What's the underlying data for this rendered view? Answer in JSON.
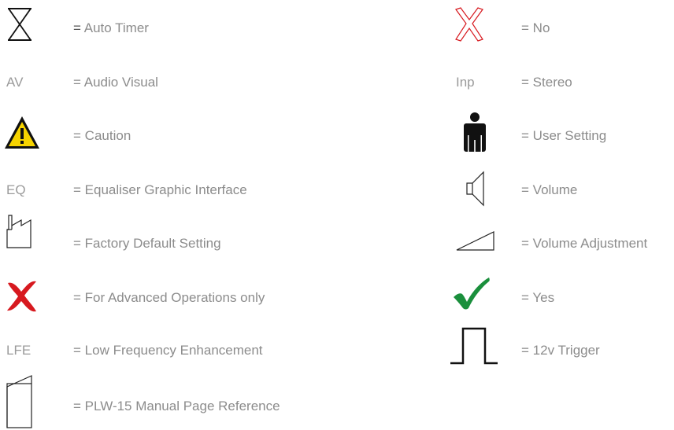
{
  "left_column": [
    {
      "icon": "hourglass-icon",
      "label": "Auto Timer"
    },
    {
      "abbr": "AV",
      "label": "Audio Visual"
    },
    {
      "icon": "caution-icon",
      "label": "Caution"
    },
    {
      "abbr": "EQ",
      "label": "Equaliser Graphic Interface"
    },
    {
      "icon": "factory-icon",
      "label": "Factory Default Setting"
    },
    {
      "icon": "red-cross-icon",
      "label": "For Advanced Operations only"
    },
    {
      "abbr": "LFE",
      "label": "Low Frequency Enhancement"
    },
    {
      "icon": "manual-page-icon",
      "label": "PLW-15 Manual Page Reference"
    }
  ],
  "right_column": [
    {
      "icon": "outline-x-icon",
      "label": "No"
    },
    {
      "abbr": "Inp",
      "label": "Stereo"
    },
    {
      "icon": "user-icon",
      "label": "User Setting"
    },
    {
      "icon": "speaker-icon",
      "label": "Volume"
    },
    {
      "icon": "volume-ramp-icon",
      "label": "Volume Adjustment"
    },
    {
      "icon": "checkmark-icon",
      "label": "Yes"
    },
    {
      "icon": "pulse-trigger-icon",
      "label": "12v Trigger"
    }
  ],
  "equals_sign": "=",
  "colors": {
    "text": "#8c8c8c",
    "red": "#d7191f",
    "green": "#1a8f3c",
    "caution_yellow": "#f7d400",
    "black": "#111111"
  }
}
